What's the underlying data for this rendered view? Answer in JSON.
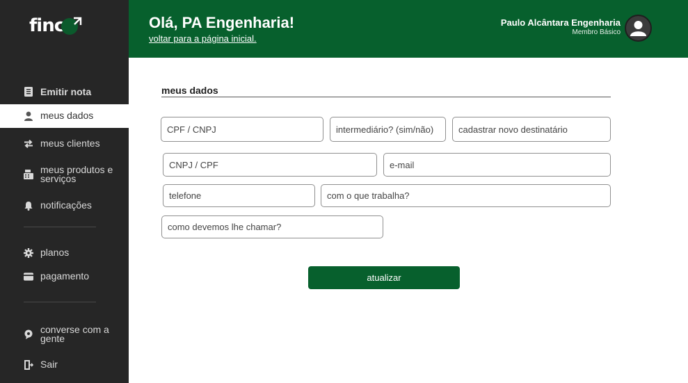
{
  "brand": {
    "logo_text": "finc",
    "accent_color": "#07602d",
    "sidebar_color": "#262626"
  },
  "sidebar": {
    "items": [
      {
        "label": "Emitir nota",
        "icon": "document-icon"
      },
      {
        "label": "meus dados",
        "icon": "user-icon"
      },
      {
        "label": "meus clientes",
        "icon": "arrows-swap-icon"
      },
      {
        "label": "meus produtos e serviços",
        "icon": "cash-register-icon"
      },
      {
        "label": "notificações",
        "icon": "bell-icon"
      },
      {
        "label": "planos",
        "icon": "gear-icon"
      },
      {
        "label": "pagamento",
        "icon": "credit-card-icon"
      },
      {
        "label": "converse com a gente",
        "icon": "chat-icon"
      },
      {
        "label": "Sair",
        "icon": "logout-icon"
      }
    ]
  },
  "header": {
    "greeting": "Olá, PA Engenharia!",
    "back_link": "voltar para a página inicial.",
    "user_name": "Paulo Alcântara Engenharia",
    "user_role": "Membro Básico"
  },
  "form": {
    "section_title": "meus dados",
    "fields": {
      "cpf_cnpj": {
        "placeholder": "CPF / CNPJ",
        "value": ""
      },
      "intermediario": {
        "placeholder": "intermediário? (sim/não)",
        "value": ""
      },
      "novo_destinatario": {
        "placeholder": "cadastrar novo destinatário",
        "value": ""
      },
      "cnpj_cpf": {
        "placeholder": "CNPJ / CPF",
        "value": ""
      },
      "email": {
        "placeholder": "e-mail",
        "value": ""
      },
      "telefone": {
        "placeholder": "telefone",
        "value": ""
      },
      "trabalho": {
        "placeholder": "com o que trabalha?",
        "value": ""
      },
      "apelido": {
        "placeholder": "como devemos lhe chamar?",
        "value": ""
      }
    },
    "submit_label": "atualizar"
  }
}
